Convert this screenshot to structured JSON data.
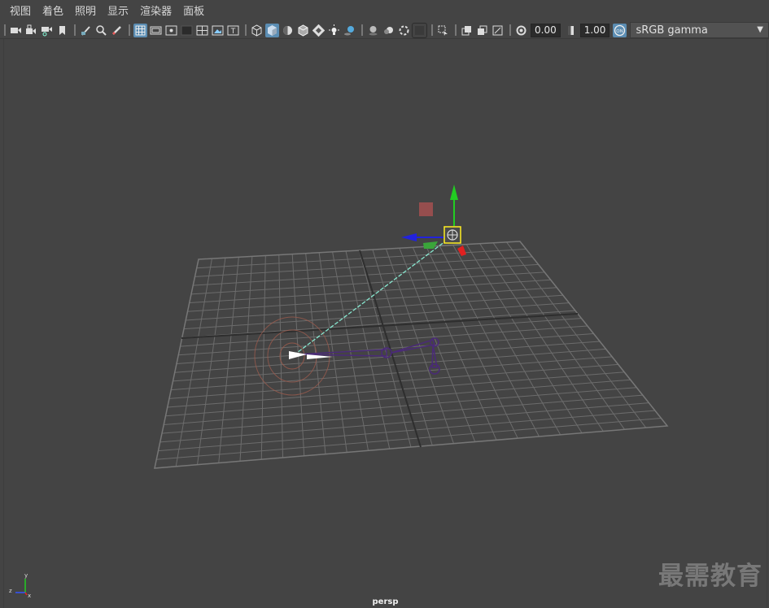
{
  "menubar": {
    "items": [
      "视图",
      "着色",
      "照明",
      "显示",
      "渲染器",
      "面板"
    ]
  },
  "toolbar": {
    "icons": [
      "select-camera-icon",
      "lock-camera-icon",
      "camera-attributes-icon",
      "bookmark-icon",
      "image-plane-icon",
      "2d-pan-zoom-icon",
      "grease-pencil-icon",
      "grid-icon",
      "film-gate-icon",
      "resolution-gate-icon",
      "gate-mask-icon",
      "field-chart-icon",
      "safe-action-icon",
      "safe-title-icon",
      "wireframe-icon",
      "smooth-shade-icon",
      "use-default-material-icon",
      "wireframe-on-shaded-icon",
      "textured-icon",
      "use-all-lights-icon",
      "shadows-icon",
      "screen-space-ao-icon",
      "motion-blur-icon",
      "multisample-aa-icon",
      "depth-of-field-icon",
      "isolate-select-icon",
      "xray-icon",
      "xray-active-components-icon",
      "xray-joints-icon",
      "exposure-icon",
      "gamma-icon",
      "color-management-icon"
    ],
    "exposure_value": "0.00",
    "gamma_value": "1.00",
    "color_space": "sRGB gamma",
    "active_color": "#5b8db3"
  },
  "viewport": {
    "camera": "persp",
    "background": "#444444",
    "grid_color": "#6b6b6b",
    "axis": {
      "z_label": "z",
      "x_label": "x",
      "y_label": "y"
    }
  },
  "watermark": "最需教育"
}
